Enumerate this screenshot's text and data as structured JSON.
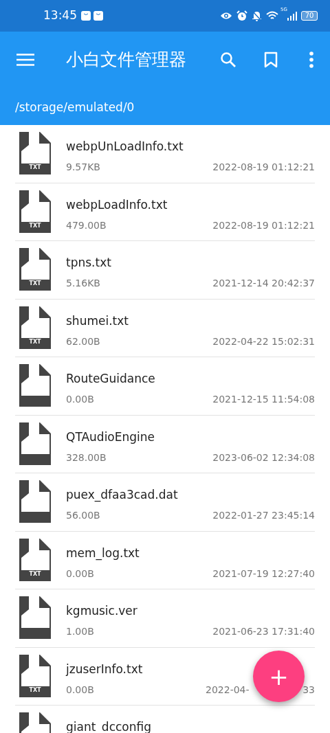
{
  "status_bar": {
    "time": "13:45",
    "network": "5G",
    "battery": "70"
  },
  "toolbar": {
    "title": "小白文件管理器"
  },
  "path": "/storage/emulated/0",
  "files": [
    {
      "kind": "txt",
      "badge": "TXT",
      "name": "webpUnLoadInfo.txt",
      "size": "9.57KB",
      "date": "2022-08-19 01:12:21"
    },
    {
      "kind": "txt",
      "badge": "TXT",
      "name": "webpLoadInfo.txt",
      "size": "479.00B",
      "date": "2022-08-19 01:12:21"
    },
    {
      "kind": "txt",
      "badge": "TXT",
      "name": "tpns.txt",
      "size": "5.16KB",
      "date": "2021-12-14 20:42:37"
    },
    {
      "kind": "txt",
      "badge": "TXT",
      "name": "shumei.txt",
      "size": "62.00B",
      "date": "2022-04-22 15:02:31"
    },
    {
      "kind": "file",
      "name": "RouteGuidance",
      "size": "0.00B",
      "date": "2021-12-15 11:54:08"
    },
    {
      "kind": "file",
      "name": "QTAudioEngine",
      "size": "328.00B",
      "date": "2023-06-02 12:34:08"
    },
    {
      "kind": "file",
      "name": "puex_dfaa3cad.dat",
      "size": "56.00B",
      "date": "2022-01-27 23:45:14"
    },
    {
      "kind": "txt",
      "badge": "TXT",
      "name": "mem_log.txt",
      "size": "0.00B",
      "date": "2021-07-19 12:27:40"
    },
    {
      "kind": "file",
      "name": "kgmusic.ver",
      "size": "1.00B",
      "date": "2021-06-23 17:31:40"
    },
    {
      "kind": "txt",
      "badge": "TXT",
      "name": "jzuserInfo.txt",
      "size": "0.00B",
      "date": "2022-04-",
      "date_end": "33"
    },
    {
      "kind": "file",
      "name": "giant_dcconfig"
    }
  ],
  "fab": {
    "label": "+"
  }
}
